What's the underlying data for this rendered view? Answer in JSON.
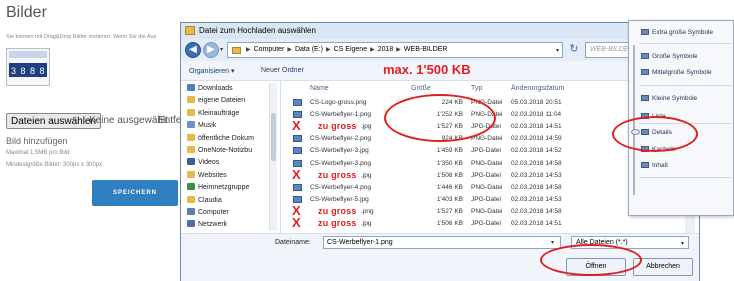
{
  "page": {
    "title": "Bilder",
    "hint": "Sie können mit Drag&Drop Bilder sortieren. Wenn Sie die Aus",
    "thumbnail_digits": "3 8 8 8",
    "file_button": "Dateien auswählen",
    "file_status": "Keine ausgewählt",
    "file_extra": "Entfe",
    "add_title": "Bild hinzufügen",
    "limit_size": "Maximal 1.5MB pro Bild",
    "limit_dim": "Mindestgröße Bilder: 300px x 300px",
    "save_button": "SPEICHERN",
    "edge_text": "x"
  },
  "dialog": {
    "title": "Datei zum Hochladen auswählen",
    "breadcrumb": [
      "Computer",
      "Data (E:)",
      "CS Eigene",
      "2018",
      "WEB-BILDER"
    ],
    "search_placeholder": "WEB-BILDER d",
    "toolbar": {
      "organize": "Organisieren ▾",
      "new_folder": "Neuer Ordner"
    },
    "annotation_max": "max. 1'500 KB",
    "nav_items": [
      {
        "label": "Downloads",
        "icon": "folder-icon",
        "color": "#4f7fc4"
      },
      {
        "label": "eigene Dateien",
        "icon": "folder-icon",
        "color": "#e8b84a"
      },
      {
        "label": "Kleinaufträge",
        "icon": "folder-icon",
        "color": "#e8b84a"
      },
      {
        "label": "Musik",
        "icon": "music-icon",
        "color": "#6d8fc8"
      },
      {
        "label": "öffentliche Dokum",
        "icon": "folder-icon",
        "color": "#e8b84a"
      },
      {
        "label": "OneNote-Notizbu",
        "icon": "folder-icon",
        "color": "#e8b84a"
      },
      {
        "label": "Videos",
        "icon": "video-icon",
        "color": "#3c5c9a"
      },
      {
        "label": "Websites",
        "icon": "folder-icon",
        "color": "#e8b84a"
      },
      {
        "label": "Heimnetzgruppe",
        "icon": "homegroup-icon",
        "color": "#3c8f4a"
      },
      {
        "label": "Claudia",
        "icon": "user-icon",
        "color": "#e8b84a"
      },
      {
        "label": "Computer",
        "icon": "computer-icon",
        "color": "#5c7fb0"
      },
      {
        "label": "Netzwerk",
        "icon": "network-icon",
        "color": "#4c72a8"
      }
    ],
    "columns": {
      "name": "Name",
      "size": "Größe",
      "type": "Typ",
      "date": "Änderungsdatum"
    },
    "files": [
      {
        "name": "CS-Logo-gross.png",
        "size": "224 KB",
        "type": "PNG-Datei",
        "date": "05.03.2018 20:51",
        "too_big": false
      },
      {
        "name": "CS-Werbeflyer-1.png",
        "size": "1'252 KB",
        "type": "PNG-Datei",
        "date": "02.03.2018 11:04",
        "too_big": false
      },
      {
        "name": ".jpg",
        "size": "1'527 KB",
        "type": "JPG-Datei",
        "date": "02.03.2018 14:51",
        "too_big": true
      },
      {
        "name": "CS-Werbeflyer-2.png",
        "size": "924 KB",
        "type": "PNG-Datei",
        "date": "02.03.2018 14:59",
        "too_big": false
      },
      {
        "name": "CS-Werbeflyer-3.jpg",
        "size": "1'459 KB",
        "type": "JPG-Datei",
        "date": "02.03.2018 14:52",
        "too_big": false
      },
      {
        "name": "CS-Werbeflyer-3.png",
        "size": "1'350 KB",
        "type": "PNG-Datei",
        "date": "02.03.2018 14:58",
        "too_big": false
      },
      {
        "name": ".jpg",
        "size": "1'508 KB",
        "type": "JPG-Datei",
        "date": "02.03.2018 14:53",
        "too_big": true
      },
      {
        "name": "CS-Werbeflyer-4.png",
        "size": "1'446 KB",
        "type": "PNG-Datei",
        "date": "02.03.2018 14:58",
        "too_big": false
      },
      {
        "name": "CS-Werbeflyer-5.jpg",
        "size": "1'403 KB",
        "type": "JPG-Datei",
        "date": "02.03.2018 14:53",
        "too_big": false
      },
      {
        "name": ".png",
        "size": "1'527 KB",
        "type": "PNG-Datei",
        "date": "02.03.2018 14:58",
        "too_big": true
      },
      {
        "name": ".jpg",
        "size": "1'506 KB",
        "type": "JPG-Datei",
        "date": "02.03.2018 14:51",
        "too_big": true
      }
    ],
    "too_big_label": "zu gross",
    "too_big_mark": "X",
    "filename_label": "Dateiname:",
    "filename_value": "CS-Werbeflyer-1.png",
    "filetype": "Alle Dateien (*.*)",
    "open_button": "Öffnen",
    "cancel_button": "Abbrechen"
  },
  "view_menu": {
    "items": [
      {
        "label": "Extra große Symbole",
        "icon": "extra-large-icons-icon"
      },
      {
        "label": "Große Symbole",
        "icon": "large-icons-icon"
      },
      {
        "label": "Mittelgroße Symbole",
        "icon": "medium-icons-icon"
      },
      {
        "label": "Kleine Symbole",
        "icon": "small-icons-icon"
      },
      {
        "label": "Liste",
        "icon": "list-view-icon"
      },
      {
        "label": "Details",
        "icon": "details-view-icon"
      },
      {
        "label": "Kacheln",
        "icon": "tiles-view-icon"
      },
      {
        "label": "Inhalt",
        "icon": "content-view-icon"
      }
    ],
    "selected": "Details"
  },
  "colors": {
    "annotation_red": "#e02020",
    "accent_blue": "#2f7fc1"
  }
}
